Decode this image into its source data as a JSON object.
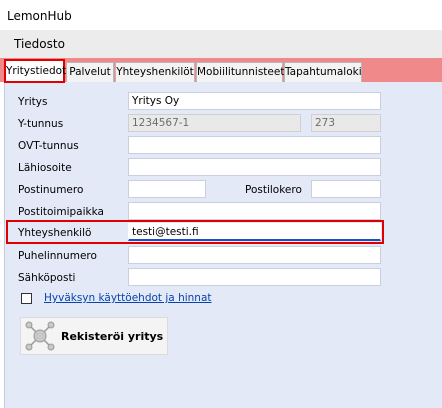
{
  "window": {
    "title": "LemonHub"
  },
  "menu": {
    "items": [
      "Tiedosto"
    ]
  },
  "tabs": [
    "Yritystiedot",
    "Palvelut",
    "Yhteyshenkilöt",
    "Mobiilitunnisteet",
    "Tapahtumaloki"
  ],
  "form": {
    "yritys": {
      "label": "Yritys",
      "value": "Yritys Oy"
    },
    "ytunnus": {
      "label": "Y-tunnus",
      "value": "1234567-1",
      "extra": "273"
    },
    "ovt": {
      "label": "OVT-tunnus",
      "value": ""
    },
    "lahiosoite": {
      "label": "Lähiosoite",
      "value": ""
    },
    "postinumero": {
      "label": "Postinumero",
      "value": ""
    },
    "postilokero": {
      "label": "Postilokero",
      "value": ""
    },
    "postitoimipaikka": {
      "label": "Postitoimipaikka",
      "value": ""
    },
    "yhteyshenkilo": {
      "label": "Yhteyshenkilö",
      "value": "testi@testi.fi"
    },
    "puhelinnumero": {
      "label": "Puhelinnumero",
      "value": ""
    },
    "sahkoposti": {
      "label": "Sähköposti",
      "value": ""
    }
  },
  "terms": {
    "label": "Hyväksyn käyttöehdot ja hinnat",
    "checked": false
  },
  "register": {
    "label": "Rekisteröi yritys",
    "icon": "network-nodes-icon"
  }
}
